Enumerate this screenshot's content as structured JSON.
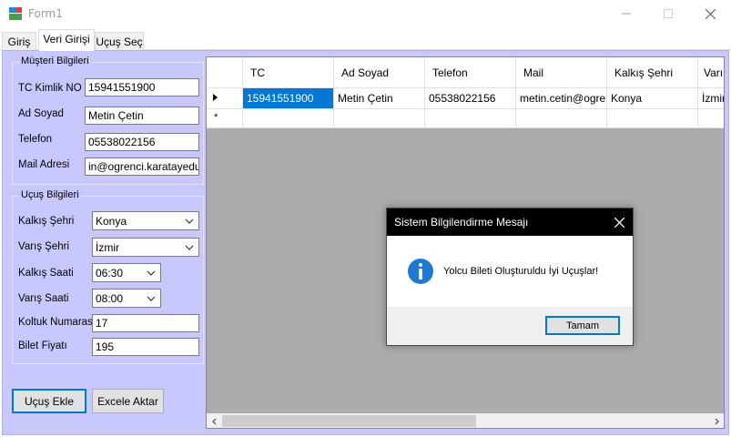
{
  "window": {
    "title": "Form1"
  },
  "tabs": [
    {
      "label": "Giriş"
    },
    {
      "label": "Veri Girişi"
    },
    {
      "label": "Uçuş Seç"
    }
  ],
  "customer_group": {
    "title": "Müşteri Bilgileri",
    "tc_label": "TC Kimlik NO",
    "tc_value": "15941551900",
    "name_label": "Ad Soyad",
    "name_value": "Metin Çetin",
    "phone_label": "Telefon",
    "phone_value": "05538022156",
    "mail_label": "Mail Adresi",
    "mail_value": "in@ogrenci.karatayedu.tr"
  },
  "flight_group": {
    "title": "Uçuş Bilgileri",
    "departure_city_label": "Kalkış Şehri",
    "departure_city_value": "Konya",
    "arrival_city_label": "Varış Şehri",
    "arrival_city_value": "İzmir",
    "departure_time_label": "Kalkış Saati",
    "departure_time_value": "06:30",
    "arrival_time_label": "Varış Saati",
    "arrival_time_value": "08:00",
    "seat_label": "Koltuk Numarası",
    "seat_value": "17",
    "price_label": "Bilet Fiyatı",
    "price_value": "195"
  },
  "buttons": {
    "add_flight": "Uçuş Ekle",
    "export_excel": "Excele Aktar"
  },
  "grid": {
    "columns": [
      "TC",
      "Ad Soyad",
      "Telefon",
      "Mail",
      "Kalkış Şehri",
      "Varı"
    ],
    "rows": [
      [
        "15941551900",
        "Metin Çetin",
        "05538022156",
        "metin.cetin@ogre...",
        "Konya",
        "İzmir"
      ]
    ],
    "new_row_marker": "*"
  },
  "dialog": {
    "title": "Sistem Bilgilendirme Mesajı",
    "message": "Yolcu Bileti Oluşturuldu İyi Uçuşlar!",
    "ok_label": "Tamam"
  },
  "colors": {
    "page_bg": "#c8c8ff",
    "selection": "#0078d7",
    "dialog_title_bg": "#000000",
    "info_icon": "#1c7ad4"
  }
}
